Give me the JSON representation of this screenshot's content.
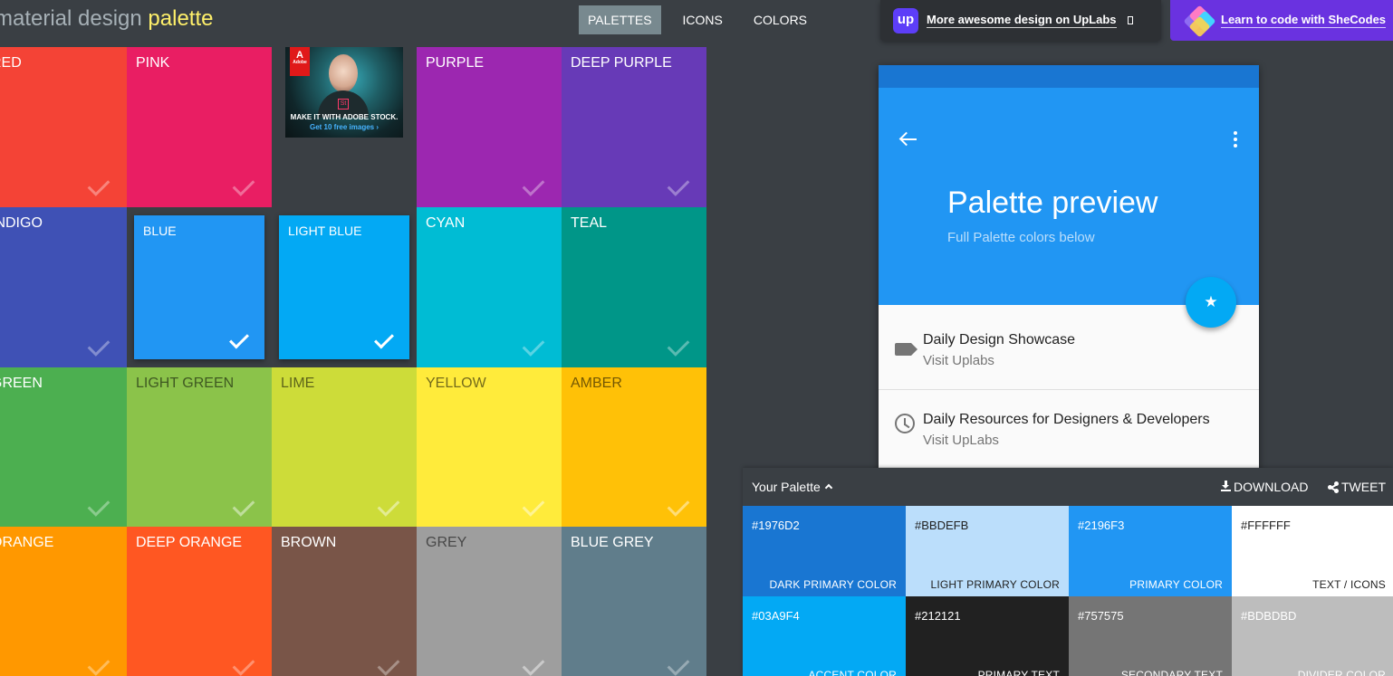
{
  "header": {
    "logo_part1": "material design",
    "logo_part2": "palette",
    "nav": [
      "PALETTES",
      "ICONS",
      "COLORS"
    ],
    "active_nav": "PALETTES",
    "promo_uplabs": {
      "logo_text": "up",
      "text": "More awesome design on UpLabs",
      "icon": "external-link-icon"
    },
    "promo_shecodes": {
      "text": "Learn to code with SheCodes",
      "icon": "diamond-logo"
    }
  },
  "swatches": [
    {
      "name": "RED",
      "color": "#f44336"
    },
    {
      "name": "PINK",
      "color": "#e91e63"
    },
    {
      "name": "PURPLE",
      "color": "#9c27b0"
    },
    {
      "name": "DEEP PURPLE",
      "color": "#673ab7"
    },
    {
      "name": "INDIGO",
      "color": "#3f51b5"
    },
    {
      "name": "BLUE",
      "color": "#2196f3",
      "selected": true
    },
    {
      "name": "LIGHT BLUE",
      "color": "#03a9f4",
      "selected": true
    },
    {
      "name": "CYAN",
      "color": "#00bcd4"
    },
    {
      "name": "TEAL",
      "color": "#009688"
    },
    {
      "name": "GREEN",
      "color": "#4caf50"
    },
    {
      "name": "LIGHT GREEN",
      "color": "#8bc34a"
    },
    {
      "name": "LIME",
      "color": "#cddc39"
    },
    {
      "name": "YELLOW",
      "color": "#ffeb3b"
    },
    {
      "name": "AMBER",
      "color": "#ffc107"
    },
    {
      "name": "ORANGE",
      "color": "#ff9800"
    },
    {
      "name": "DEEP ORANGE",
      "color": "#ff5722"
    },
    {
      "name": "BROWN",
      "color": "#795548"
    },
    {
      "name": "GREY",
      "color": "#9e9e9e"
    },
    {
      "name": "BLUE GREY",
      "color": "#607d8b"
    }
  ],
  "ad": {
    "brand": "Adobe",
    "product_mark": "St",
    "headline": "MAKE IT WITH ADOBE STOCK.",
    "cta": "Get 10 free images ›"
  },
  "preview": {
    "title": "Palette preview",
    "subtitle": "Full Palette colors below",
    "back_icon": "arrow-back-icon",
    "menu_icon": "more-vert-icon",
    "fab_icon": "star-icon",
    "fab_glyph": "★",
    "items": [
      {
        "title": "Daily Design Showcase",
        "subtitle": "Visit Uplabs",
        "icon": "label-icon"
      },
      {
        "title": "Daily Resources for Designers & Developers",
        "subtitle": "Visit UpLabs",
        "icon": "clock-icon"
      }
    ],
    "colors": {
      "dark_primary": "#1976D2",
      "primary": "#2196F3",
      "accent": "#03A9F4"
    }
  },
  "your_palette": {
    "title": "Your Palette",
    "download": "DOWNLOAD",
    "tweet": "TWEET",
    "colors": [
      {
        "hex": "#1976D2",
        "role": "DARK PRIMARY COLOR",
        "bg": "#1976d2",
        "fg": "#ffffff"
      },
      {
        "hex": "#BBDEFB",
        "role": "LIGHT PRIMARY COLOR",
        "bg": "#bbdefb",
        "fg": "#212121"
      },
      {
        "hex": "#2196F3",
        "role": "PRIMARY COLOR",
        "bg": "#2196f3",
        "fg": "#ffffff"
      },
      {
        "hex": "#FFFFFF",
        "role": "TEXT / ICONS",
        "bg": "#ffffff",
        "fg": "#212121"
      },
      {
        "hex": "#03A9F4",
        "role": "ACCENT COLOR",
        "bg": "#03a9f4",
        "fg": "#ffffff"
      },
      {
        "hex": "#212121",
        "role": "PRIMARY TEXT",
        "bg": "#212121",
        "fg": "#ffffff"
      },
      {
        "hex": "#757575",
        "role": "SECONDARY TEXT",
        "bg": "#757575",
        "fg": "#ffffff"
      },
      {
        "hex": "#BDBDBD",
        "role": "DIVIDER COLOR",
        "bg": "#bdbdbd",
        "fg": "#ffffff"
      }
    ]
  }
}
